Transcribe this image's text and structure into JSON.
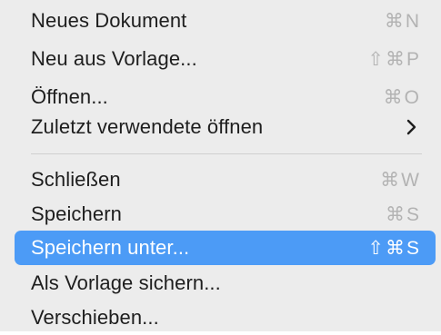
{
  "menu": {
    "items": [
      {
        "label": "Neues Dokument",
        "shortcut": "⌘N"
      },
      {
        "label": "Neu aus Vorlage...",
        "shortcut": "⇧⌘P"
      },
      {
        "label": "Öffnen...",
        "shortcut": "⌘O"
      },
      {
        "label": "Zuletzt verwendete öffnen",
        "submenu_icon": "chevron-right-icon"
      },
      {
        "label": "Schließen",
        "shortcut": "⌘W"
      },
      {
        "label": "Speichern",
        "shortcut": "⌘S"
      },
      {
        "label": "Speichern unter...",
        "shortcut": "⇧⌘S",
        "selected": true
      },
      {
        "label": "Als Vorlage sichern...",
        "shortcut": ""
      },
      {
        "label": "Verschieben...",
        "shortcut": ""
      }
    ]
  },
  "colors": {
    "menu_background": "#ececec",
    "selection": "#4c9bf6",
    "text": "#1e1e1e",
    "shortcut_text": "#b3b3b3"
  }
}
